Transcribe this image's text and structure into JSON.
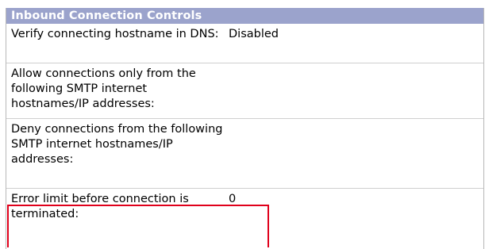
{
  "section": {
    "title": "Inbound Connection Controls"
  },
  "settings": [
    {
      "label": "Verify connecting hostname in DNS:",
      "value": "Disabled"
    },
    {
      "label": "Allow connections only from the following SMTP internet hostnames/IP addresses:",
      "value": ""
    },
    {
      "label": "Deny connections from the following SMTP internet hostnames/IP addresses:",
      "value": ""
    },
    {
      "label": "Error limit before connection is terminated:",
      "value": "0"
    }
  ],
  "highlight": {
    "color": "#e0001b",
    "target": "error-limit-row"
  },
  "colors": {
    "header_background": "#9ba3cc",
    "header_text": "#ffffff"
  }
}
